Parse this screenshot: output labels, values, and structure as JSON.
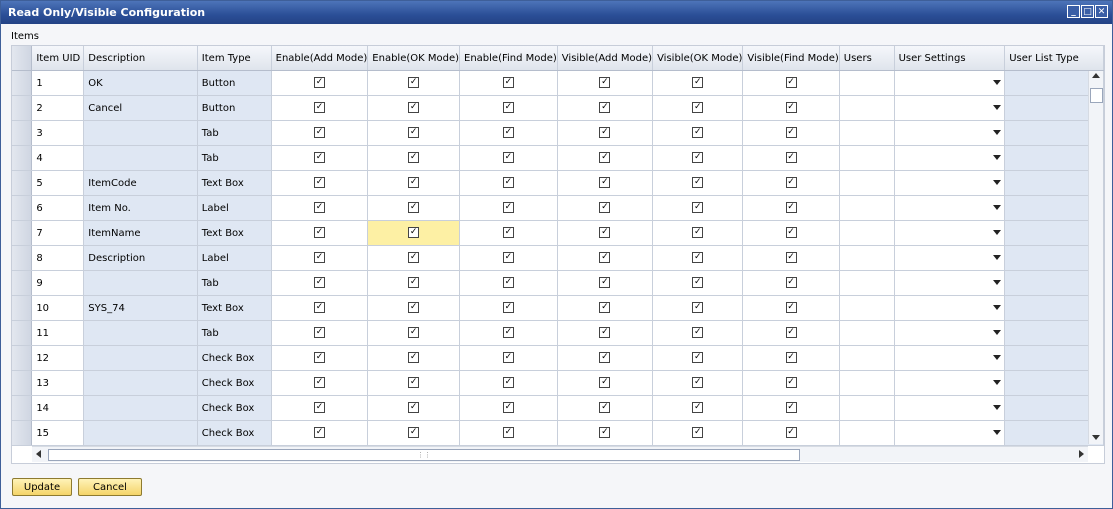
{
  "window": {
    "title": "Read Only/Visible Configuration",
    "controls": [
      "minimize-icon",
      "maximize-icon",
      "close-icon"
    ]
  },
  "items_label": "Items",
  "columns": [
    "Item UID",
    "Description",
    "Item Type",
    "Enable(Add Mode)",
    "Enable(OK Mode)",
    "Enable(Find Mode)",
    "Visible(Add Mode)",
    "Visible(OK Mode)",
    "Visible(Find Mode)",
    "Users",
    "User Settings",
    "User List Type"
  ],
  "rows": [
    {
      "uid": "1",
      "description": "OK",
      "type": "Button"
    },
    {
      "uid": "2",
      "description": "Cancel",
      "type": "Button"
    },
    {
      "uid": "3",
      "description": "",
      "type": "Tab"
    },
    {
      "uid": "4",
      "description": "",
      "type": "Tab"
    },
    {
      "uid": "5",
      "description": "ItemCode",
      "type": "Text Box"
    },
    {
      "uid": "6",
      "description": "Item No.",
      "type": "Label"
    },
    {
      "uid": "7",
      "description": "ItemName",
      "type": "Text Box"
    },
    {
      "uid": "8",
      "description": "Description",
      "type": "Label"
    },
    {
      "uid": "9",
      "description": "",
      "type": "Tab"
    },
    {
      "uid": "10",
      "description": "SYS_74",
      "type": "Text Box"
    },
    {
      "uid": "11",
      "description": "",
      "type": "Tab"
    },
    {
      "uid": "12",
      "description": "",
      "type": "Check Box"
    },
    {
      "uid": "13",
      "description": "",
      "type": "Check Box"
    },
    {
      "uid": "14",
      "description": "",
      "type": "Check Box"
    },
    {
      "uid": "15",
      "description": "",
      "type": "Check Box"
    }
  ],
  "checkbox_checked": true,
  "highlight": {
    "row": 7,
    "column": "Enable(OK Mode)",
    "color": "#fdf0a4"
  },
  "buttons": {
    "update": "Update",
    "cancel": "Cancel"
  },
  "colors": {
    "titlebar": "#2b4f97",
    "button_bg": "#f4d46a",
    "readonly_cell": "#dfe7f3"
  }
}
